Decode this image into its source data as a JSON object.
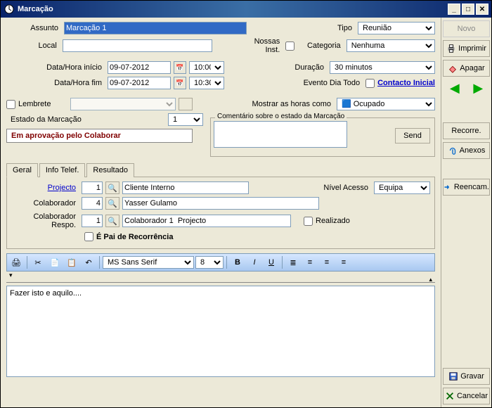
{
  "window": {
    "title": "Marcação"
  },
  "labels": {
    "assunto": "Assunto",
    "local": "Local",
    "tipo": "Tipo",
    "nossas_inst": "Nossas Inst.",
    "categoria": "Categoria",
    "data_inicio": "Data/Hora início",
    "data_fim": "Data/Hora fim",
    "duracao": "Duração",
    "evento_dia_todo": "Evento Dia Todo",
    "contacto_inicial": "Contacto Inicial",
    "lembrete": "Lembrete",
    "mostrar_como": "Mostrar as horas como",
    "estado": "Estado da Marcação",
    "comentario": "Comentário sobre o estado da Marcação",
    "send": "Send",
    "projecto": "Projecto",
    "colaborador": "Colaborador",
    "colab_respo": "Colaborador Respo.",
    "nivel_acesso": "Nível Acesso",
    "realizado": "Realizado",
    "pai_recorrencia": "É Pai de Recorrência",
    "cliente_interno": "Cliente Interno",
    "yasser": "Yasser Gulamo",
    "colab1_proj": "Colaborador 1  Projecto"
  },
  "values": {
    "assunto": "Marcação 1",
    "tipo": "Reunião",
    "categoria": "Nenhuma",
    "data_inicio": "09-07-2012",
    "hora_inicio": "10:00",
    "data_fim": "09-07-2012",
    "hora_fim": "10:30",
    "duracao": "30 minutos",
    "ocupado": "Ocupado",
    "estado_num": "1",
    "estado_text": "Em aprovação pelo Colaborar",
    "projecto_num": "1",
    "colaborador_num": "4",
    "colab_respo_num": "1",
    "nivel_acesso": "Equipa",
    "font_name": "MS Sans Serif",
    "font_size": "8",
    "body_text": "Fazer isto e aquilo...."
  },
  "tabs": {
    "geral": "Geral",
    "info_telef": "Info Telef.",
    "resultado": "Resultado"
  },
  "sidebar": {
    "novo": "Novo",
    "imprimir": "Imprimir",
    "apagar": "Apagar",
    "recorre": "Recorre.",
    "anexos": "Anexos",
    "reencam": "Reencam.",
    "gravar": "Gravar",
    "cancelar": "Cancelar"
  }
}
